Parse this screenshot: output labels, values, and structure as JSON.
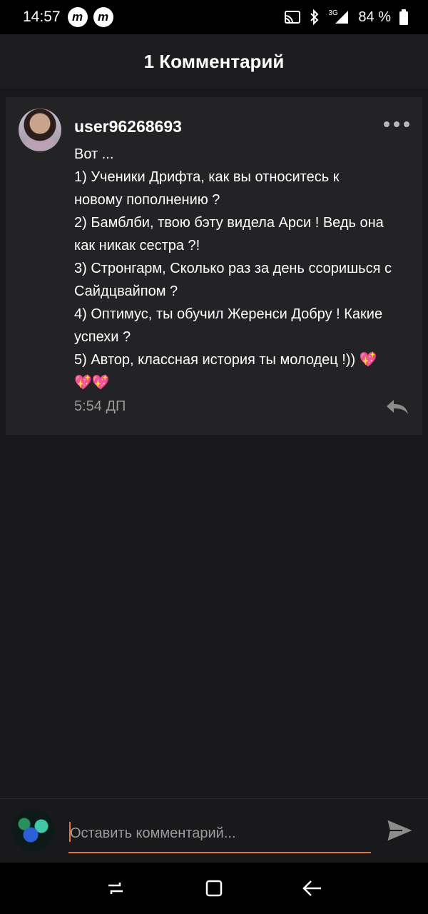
{
  "status_bar": {
    "time": "14:57",
    "app_badges": [
      "m",
      "m"
    ],
    "network": "3G",
    "battery": "84 %"
  },
  "header": {
    "title": "1 Комментарий"
  },
  "comment": {
    "username": "user96268693",
    "lines": [
      "Вот ...",
      "1) Ученики Дрифта, как вы относитесь к",
      "новому пополнению ?",
      "2) Бамблби, твою бэту видела Арси ! Ведь она",
      "как никак сестра ?!",
      "3) Стронгарм, Сколько раз за день ссоришься с",
      "Сайдцвайпом ?",
      "4) Оптимус, ты обучил Жеренси Добру ! Какие",
      "успехи ?",
      "5) Автор, классная история ты молодец !)) 💖",
      "💖💖"
    ],
    "timestamp": "5:54 ДП"
  },
  "compose": {
    "placeholder": "Оставить комментарий..."
  },
  "colors": {
    "accent": "#e1743f",
    "background": "#19181a",
    "card": "#232224"
  },
  "icons": {
    "more": "more-dots-icon",
    "reply": "reply-icon",
    "send": "send-icon"
  }
}
